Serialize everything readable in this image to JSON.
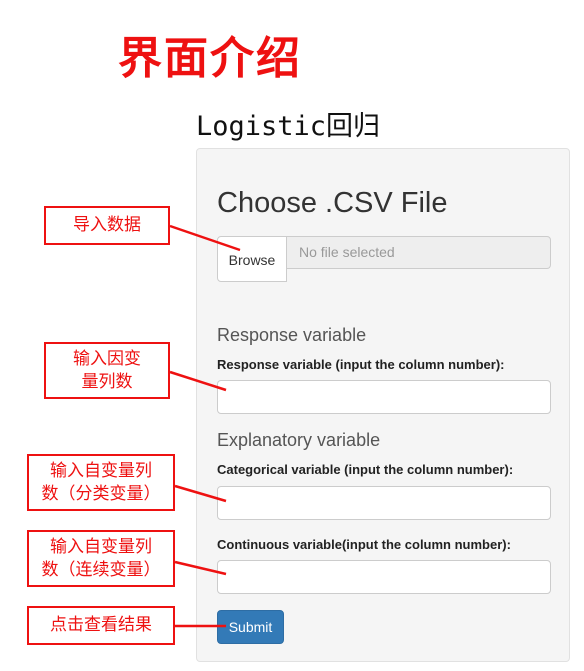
{
  "page_title": "界面介绍",
  "app_title": "Logistic回归",
  "panel": {
    "heading": "Choose .CSV File",
    "browse_label": "Browse",
    "file_placeholder": "No file selected",
    "response_section": "Response variable",
    "response_label": "Response variable (input the column number):",
    "response_value": "",
    "explanatory_section": "Explanatory variable",
    "categorical_label": "Categorical variable (input the column number):",
    "categorical_value": "",
    "continuous_label": "Continuous variable(input the column number):",
    "continuous_value": "",
    "submit_label": "Submit"
  },
  "callouts": {
    "import_data": "导入数据",
    "response_line1": "输入因变",
    "response_line2": "量列数",
    "categorical_line1": "输入自变量列",
    "categorical_line2": "数（分类变量）",
    "continuous_line1": "输入自变量列",
    "continuous_line2": "数（连续变量）",
    "submit_hint": "点击查看结果"
  },
  "colors": {
    "annotation_red": "#ee1111",
    "panel_bg": "#f5f5f5",
    "primary_button": "#337ab7"
  }
}
